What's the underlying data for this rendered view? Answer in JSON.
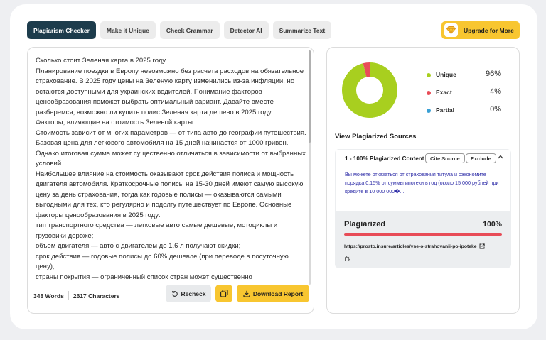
{
  "colors": {
    "accent": "#f8c630",
    "active_tab": "#1d3c4c",
    "unique": "#a8cf1f",
    "exact": "#e84c57",
    "partial": "#3aa0d5"
  },
  "tabs": [
    {
      "label": "Plagiarism Checker",
      "active": true
    },
    {
      "label": "Make it Unique",
      "active": false
    },
    {
      "label": "Check Grammar",
      "active": false
    },
    {
      "label": "Detector AI",
      "active": false
    },
    {
      "label": "Summarize Text",
      "active": false
    }
  ],
  "upgrade": {
    "label": "Upgrade for More",
    "icon": "diamond-icon"
  },
  "editor": {
    "paragraphs": [
      "Сколько стоит Зеленая карта в 2025 году",
      "Планирование поездки в Европу невозможно без расчета расходов на обязательное страхование. В 2025 году цены на Зеленую карту изменились из-за инфляции, но остаются доступными для украинских водителей. Понимание факторов ценообразования поможет выбрать оптимальный вариант. Давайте вместе разберемся, возможно ли купить полис Зеленая карта дешево в 2025 году.",
      "Факторы, влияющие на стоимость Зеленой карты",
      "Стоимость зависит от многих параметров — от типа авто до географии путешествия. Базовая цена для легкового автомобиля на 15 дней начинается от 1000 гривен. Однако итоговая сумма может существенно отличаться в зависимости от выбранных условий.",
      "Наибольшее влияние на стоимость оказывают срок действия полиса и мощность двигателя автомобиля. Краткосрочные полисы на 15-30 дней имеют самую высокую цену за день страхования, тогда как годовые полисы — оказываются самыми выгодными для тех, кто регулярно и подолгу путешествует по Европе. Основные факторы ценообразования в 2025 году:",
      "тип транспортного средства — легковые авто самые дешевые, мотоциклы и грузовики дороже;",
      "объем двигателя — авто с двигателем до 1,6 л получают скидки;",
      "срок действия — годовые полисы до 60% дешевле (при переводе в посуточную цену);",
      "страны покрытия — ограниченный список стран может существенно"
    ],
    "word_count": "348 Words",
    "char_count": "2617 Characters",
    "recheck_label": "Recheck",
    "download_label": "Download Report"
  },
  "results": {
    "legend": [
      {
        "name": "Unique",
        "value": "96%",
        "percent": 96,
        "color_key": "unique"
      },
      {
        "name": "Exact",
        "value": "4%",
        "percent": 4,
        "color_key": "exact"
      },
      {
        "name": "Partial",
        "value": "0%",
        "percent": 0,
        "color_key": "partial"
      }
    ],
    "sources_heading": "View Plagiarized Sources",
    "source": {
      "title": "1 - 100% Plagiarized Content",
      "cite_label": "Cite Source",
      "exclude_label": "Exclude",
      "snippet": "Вы можете отказаться от страхования титула и сэкономите порядка 0,15% от суммы ипотеки в год (около 15 000 рублей при кредите в 10 000 000�...",
      "plagiarized_label": "Plagiarized",
      "plagiarized_value": "100%",
      "plagiarized_percent": 100,
      "url": "https://prosto.insure/articles/vse-o-strahovanii-po-ipoteke"
    }
  }
}
